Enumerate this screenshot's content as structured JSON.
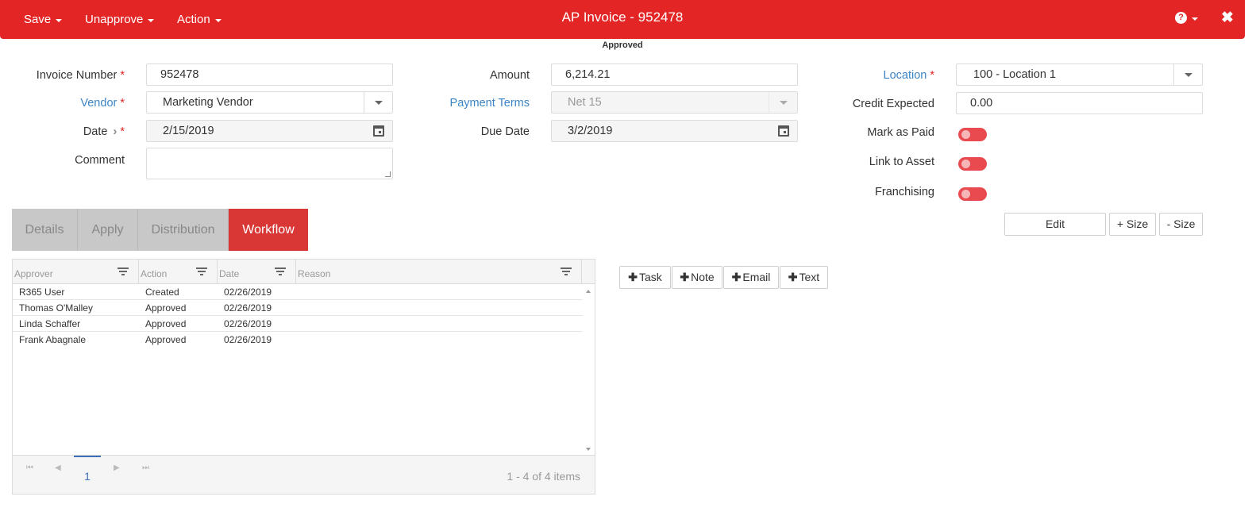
{
  "header": {
    "save_label": "Save",
    "unapprove_label": "Unapprove",
    "action_label": "Action",
    "title": "AP Invoice - 952478",
    "help_glyph": "?",
    "close_glyph": "✖",
    "status": "Approved",
    "bar_color": "#e32525"
  },
  "form": {
    "invoice_number": {
      "label": "Invoice Number",
      "value": "952478"
    },
    "vendor": {
      "label": "Vendor",
      "value": "Marketing Vendor"
    },
    "date": {
      "label": "Date",
      "value": "2/15/2019"
    },
    "comment": {
      "label": "Comment",
      "value": ""
    },
    "amount": {
      "label": "Amount",
      "value": "6,214.21"
    },
    "payment_terms": {
      "label": "Payment Terms",
      "value": "Net 15"
    },
    "due_date": {
      "label": "Due Date",
      "value": "3/2/2019"
    },
    "location": {
      "label": "Location",
      "value": "100 - Location 1"
    },
    "credit_expected": {
      "label": "Credit Expected",
      "value": "0.00"
    },
    "mark_as_paid": {
      "label": "Mark as Paid",
      "on": false
    },
    "link_to_asset": {
      "label": "Link to Asset",
      "on": false
    },
    "franchising": {
      "label": "Franchising",
      "on": false
    },
    "required_marker": "*",
    "date_chevron": "›"
  },
  "layout_buttons": {
    "edit": "Edit",
    "plus_size": "+ Size",
    "minus_size": "- Size"
  },
  "tabs": [
    {
      "label": "Details",
      "active": false
    },
    {
      "label": "Apply",
      "active": false
    },
    {
      "label": "Distribution",
      "active": false
    },
    {
      "label": "Workflow",
      "active": true
    }
  ],
  "workflow_grid": {
    "columns": [
      "Approver",
      "Action",
      "Date",
      "Reason"
    ],
    "rows": [
      {
        "approver": "R365 User",
        "action": "Created",
        "date": "02/26/2019",
        "reason": ""
      },
      {
        "approver": "Thomas O'Malley",
        "action": "Approved",
        "date": "02/26/2019",
        "reason": ""
      },
      {
        "approver": "Linda Schaffer",
        "action": "Approved",
        "date": "02/26/2019",
        "reason": ""
      },
      {
        "approver": "Frank Abagnale",
        "action": "Approved",
        "date": "02/26/2019",
        "reason": ""
      }
    ],
    "pager": {
      "current_page": "1",
      "info": "1 - 4 of 4 items",
      "first": "⏮",
      "prev": "◀",
      "next": "▶",
      "last": "⏭"
    }
  },
  "actions": {
    "plus_glyph": "✚",
    "task": "Task",
    "note": "Note",
    "email": "Email",
    "text": "Text"
  }
}
